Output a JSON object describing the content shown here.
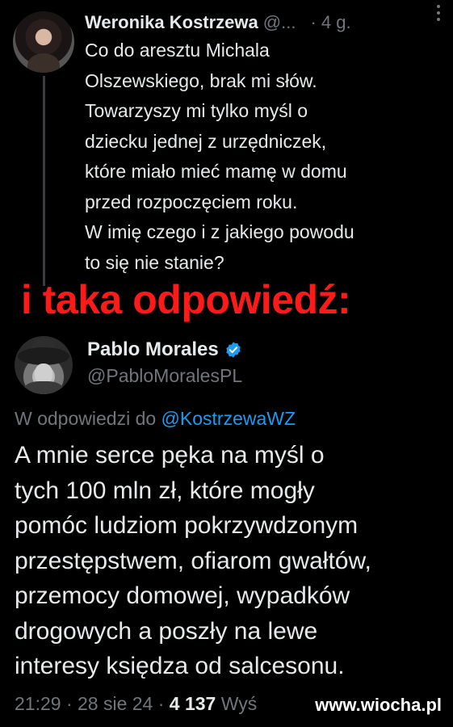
{
  "tweet1": {
    "author_name": "Weronika Kostrzewa",
    "author_handle": "@...",
    "time": "· 4 g.",
    "more_icon": "more-vertical-icon",
    "lines": [
      "Co do aresztu Michala",
      "Olszewskiego, brak mi słów.",
      "Towarzyszy mi tylko myśl o",
      "dziecku jednej z urzędniczek,",
      "które miało mieć mamę w domu",
      "przed rozpoczęciem roku.",
      "W imię czego i z jakiego powodu",
      "to się nie stanie?"
    ]
  },
  "caption": {
    "text": "i taka odpowiedź:",
    "color": "#ff1a1a"
  },
  "tweet2": {
    "author_name": "Pablo Morales",
    "verified_icon": "verified-badge-icon",
    "verified_color": "#1d9bf0",
    "author_handle": "@PabloMoralesPL",
    "reply_prefix": "W odpowiedzi do",
    "reply_mention": "@KostrzewaWZ",
    "lines": [
      "A mnie serce pęka na myśl o",
      "tych 100 mln zł, które mogły",
      "pomóc ludziom pokrzywdzonym",
      "przestępstwem, ofiarom gwałtów,",
      "przemocy domowej, wypadków",
      "drogowych a poszły na lewe",
      "interesy księdza od salcesonu."
    ],
    "meta_time": "21:29 · 28 sie 24 ·",
    "meta_views": "4 137",
    "meta_views_label": "Wyś"
  },
  "watermark": {
    "text": "www.wiocha.pl"
  },
  "colors": {
    "background": "#000000",
    "text": "#e7e9ea",
    "muted": "#71767b",
    "link": "#1d9bf0"
  }
}
